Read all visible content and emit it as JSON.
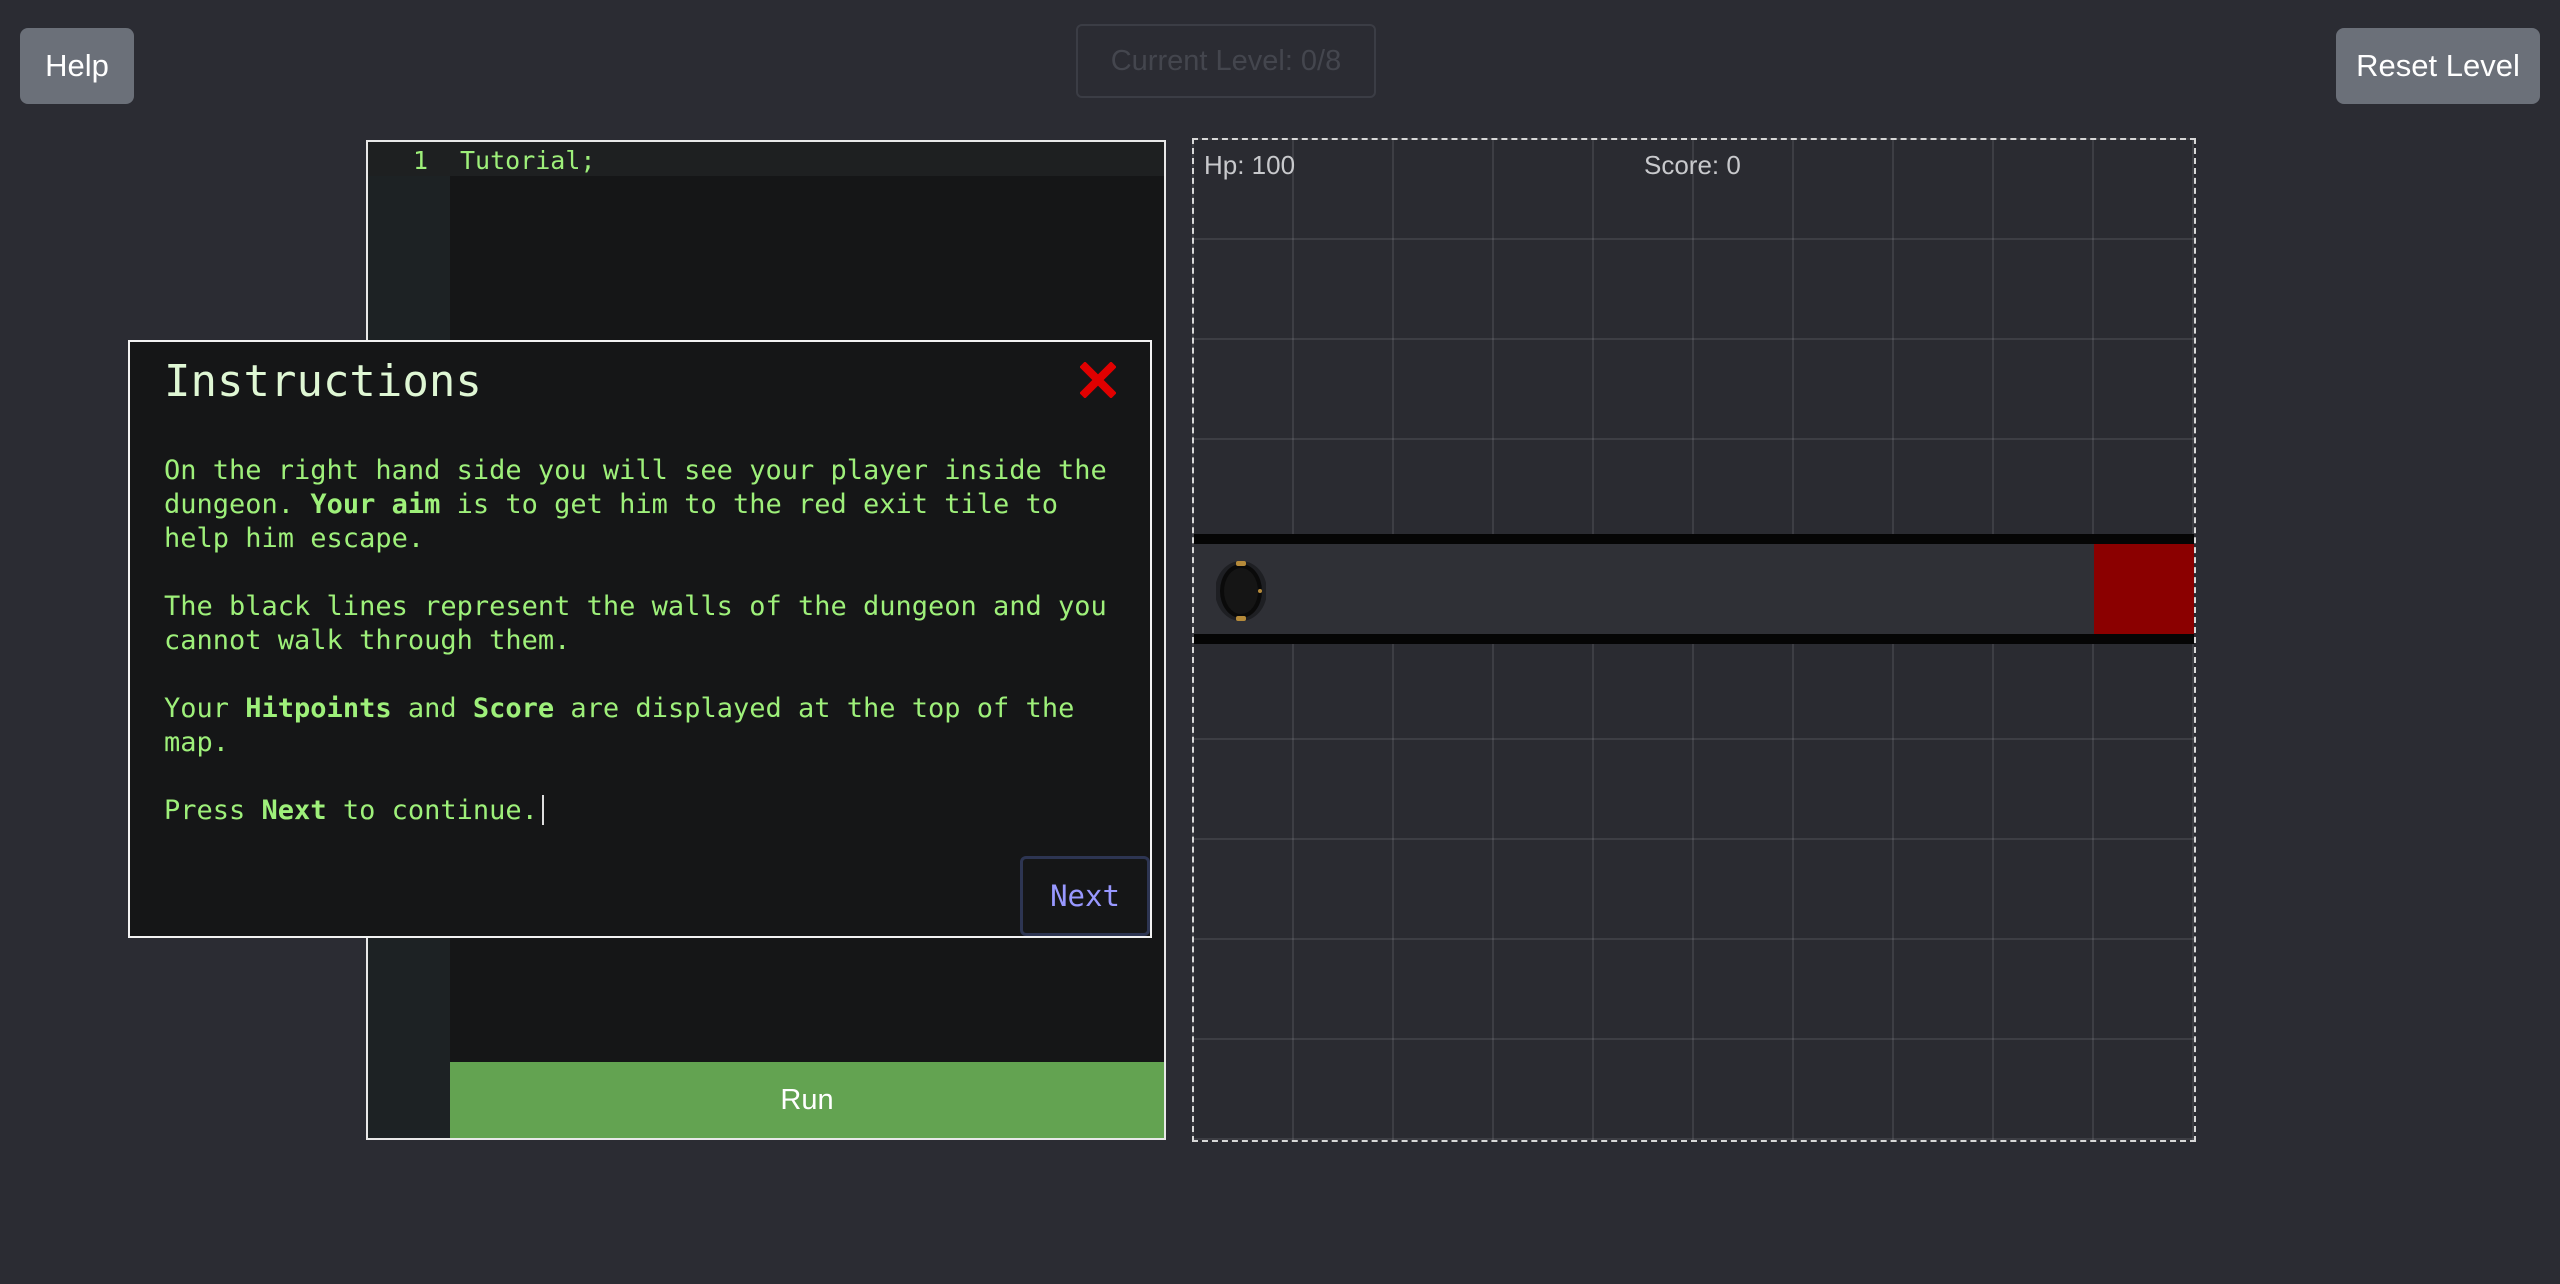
{
  "header": {
    "help_label": "Help",
    "level_label": "Current Level: 0/8",
    "reset_label": "Reset Level"
  },
  "editor": {
    "line_number": "1",
    "code": "Tutorial;",
    "run_label": "Run"
  },
  "game": {
    "hp_text": "Hp: 100",
    "score_text": "Score: 0",
    "exit_color": "#8b0000",
    "wall_color": "#050505"
  },
  "modal": {
    "title": "Instructions",
    "close_icon": "close-icon",
    "paragraphs": {
      "p1_a": "On the right hand side you will see your player inside the dungeon. ",
      "p1_bold": "Your aim",
      "p1_b": " is to get him to the red exit tile to help him escape.",
      "p2": "The black lines represent the walls of the dungeon and you cannot walk through them.",
      "p3_a": "Your ",
      "p3_bold1": "Hitpoints",
      "p3_b": " and ",
      "p3_bold2": "Score",
      "p3_c": " are displayed at the top of the map.",
      "p4_a": "Press ",
      "p4_bold": "Next",
      "p4_b": " to continue."
    },
    "next_label": "Next"
  },
  "colors": {
    "accent_green": "#9ef07a",
    "run_button": "#63a351",
    "next_text": "#9898ff",
    "close_red": "#e00000"
  }
}
